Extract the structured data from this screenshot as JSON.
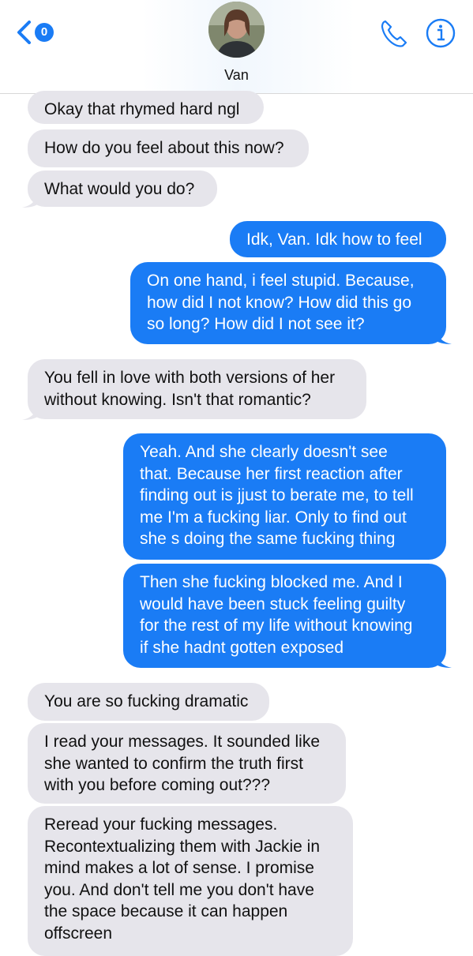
{
  "header": {
    "badge_count": "0",
    "contact_name": "Van",
    "back_icon": "chevron-left-icon",
    "call_icon": "phone-icon",
    "info_icon": "info-icon",
    "accent": "#1a7cf5"
  },
  "messages": [
    {
      "dir": "in",
      "text": "Okay that rhymed hard ngl"
    },
    {
      "dir": "in",
      "text": "How do you feel about this now?"
    },
    {
      "dir": "in",
      "text": "What would you do?"
    },
    {
      "dir": "out",
      "text": "Idk, Van. Idk how to feel"
    },
    {
      "dir": "out",
      "text": "On one hand, i feel stupid. Because,\nhow did I not know? How did this go\nso long? How did I not see it?"
    },
    {
      "dir": "in",
      "text": "You fell in love with both versions of her\nwithout knowing. Isn't that romantic?"
    },
    {
      "dir": "out",
      "text": "Yeah. And she clearly doesn't see\nthat. Because her first reaction after\nfinding out is jjust to berate me, to tell\nme I'm a fucking liar. Only to find out\nshe s doing the same fucking thing"
    },
    {
      "dir": "out",
      "text": "Then she fucking blocked me. And I\nwould have been stuck feeling guilty\nfor the rest of my life without knowing\nif she hadnt gotten exposed"
    },
    {
      "dir": "in",
      "text": "You are so fucking dramatic"
    },
    {
      "dir": "in",
      "text": "I read your messages. It sounded like\nshe wanted to confirm the truth first\nwith you before coming out???"
    },
    {
      "dir": "in",
      "text": "Reread your fucking messages.\nRecontextualizing them with Jackie in\nmind makes a lot of sense. I promise\nyou. And don't tell me you don't have\nthe space because it can happen\noffscreen"
    }
  ]
}
